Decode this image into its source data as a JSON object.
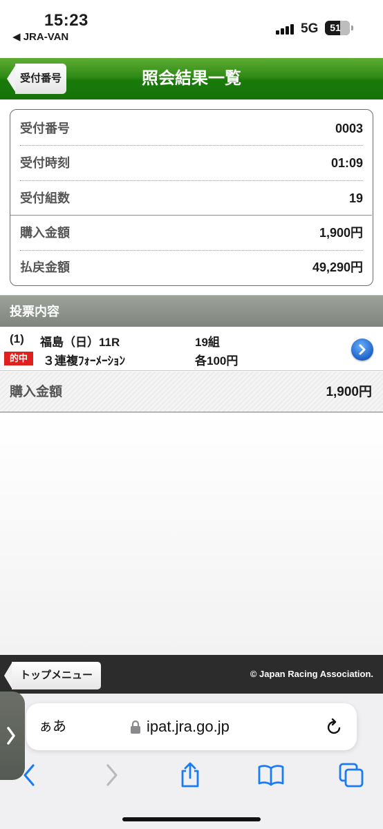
{
  "status_bar": {
    "time": "15:23",
    "back_app": "◀ JRA-VAN",
    "network": "5G",
    "battery": "51"
  },
  "header": {
    "back_label": "受付番号",
    "title": "照会結果一覧"
  },
  "summary": {
    "rows": [
      {
        "label": "受付番号",
        "value": "0003"
      },
      {
        "label": "受付時刻",
        "value": "01:09"
      },
      {
        "label": "受付組数",
        "value": "19"
      },
      {
        "label": "購入金額",
        "value": "1,900円"
      },
      {
        "label": "払戻金額",
        "value": "49,290円"
      }
    ]
  },
  "bets": {
    "section_title": "投票内容",
    "items": [
      {
        "index": "(1)",
        "race": "福島（日）11R",
        "combos": "19組",
        "hit_badge": "的中",
        "bet_type": "３連複ﾌｫｰﾒｰｼｮﾝ",
        "unit_price": "各100円"
      }
    ]
  },
  "purchase": {
    "label": "購入金額",
    "value": "1,900円"
  },
  "footer": {
    "top_menu_label": "トップメニュー",
    "copyright": "© Japan Racing Association."
  },
  "browser": {
    "aa_label": "ぁあ",
    "url": "ipat.jra.go.jp"
  },
  "colors": {
    "header_green": "#2f8a17",
    "hit_red": "#e0201c",
    "link_blue": "#1d63c7",
    "toolbar_blue": "#1a7cf5"
  }
}
